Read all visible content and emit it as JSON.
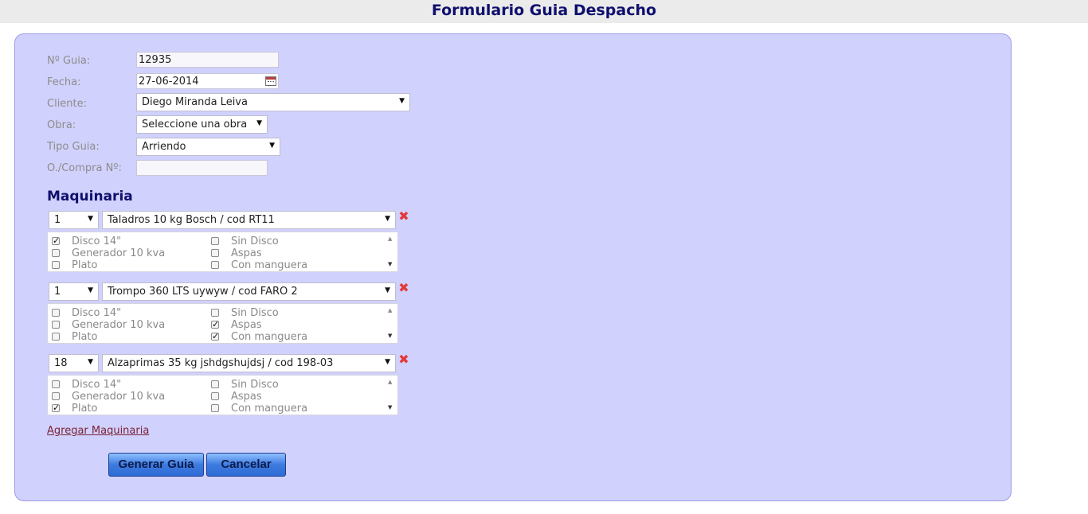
{
  "page_title": "Formulario Guia Despacho",
  "form": {
    "guia": {
      "label": "Nº Guia:",
      "value": "12935"
    },
    "fecha": {
      "label": "Fecha:",
      "value": "27-06-2014"
    },
    "cliente": {
      "label": "Cliente:",
      "value": "Diego Miranda Leiva"
    },
    "obra": {
      "label": "Obra:",
      "value": "Seleccione una obra"
    },
    "tipo_guia": {
      "label": "Tipo Guia:",
      "value": "Arriendo"
    },
    "oc": {
      "label": "O./Compra Nº:",
      "value": ""
    }
  },
  "maquinaria": {
    "title": "Maquinaria",
    "items": [
      {
        "qty": "1",
        "machine": "Taladros 10 kg Bosch / cod RT11",
        "options": [
          {
            "label": "Disco 14\"",
            "checked": true
          },
          {
            "label": "Sin Disco",
            "checked": false
          },
          {
            "label": "Generador 10 kva",
            "checked": false
          },
          {
            "label": "Aspas",
            "checked": false
          },
          {
            "label": "Plato",
            "checked": false
          },
          {
            "label": "Con manguera",
            "checked": false
          }
        ]
      },
      {
        "qty": "1",
        "machine": "Trompo 360 LTS uywyw / cod FARO 2",
        "options": [
          {
            "label": "Disco 14\"",
            "checked": false
          },
          {
            "label": "Sin Disco",
            "checked": false
          },
          {
            "label": "Generador 10 kva",
            "checked": false
          },
          {
            "label": "Aspas",
            "checked": true
          },
          {
            "label": "Plato",
            "checked": false
          },
          {
            "label": "Con manguera",
            "checked": true
          }
        ]
      },
      {
        "qty": "18",
        "machine": "Alzaprimas 35 kg jshdgshujdsj / cod 198-03",
        "options": [
          {
            "label": "Disco 14\"",
            "checked": false
          },
          {
            "label": "Sin Disco",
            "checked": false
          },
          {
            "label": "Generador 10 kva",
            "checked": false
          },
          {
            "label": "Aspas",
            "checked": false
          },
          {
            "label": "Plato",
            "checked": true
          },
          {
            "label": "Con manguera",
            "checked": false
          }
        ]
      }
    ],
    "add_link": "Agregar Maquinaria"
  },
  "buttons": {
    "generate": "Generar Guia",
    "cancel": "Cancelar"
  },
  "colors": {
    "panel": "#d1d1fd",
    "title": "#0f0f6e",
    "delete": "#e23a3a"
  }
}
